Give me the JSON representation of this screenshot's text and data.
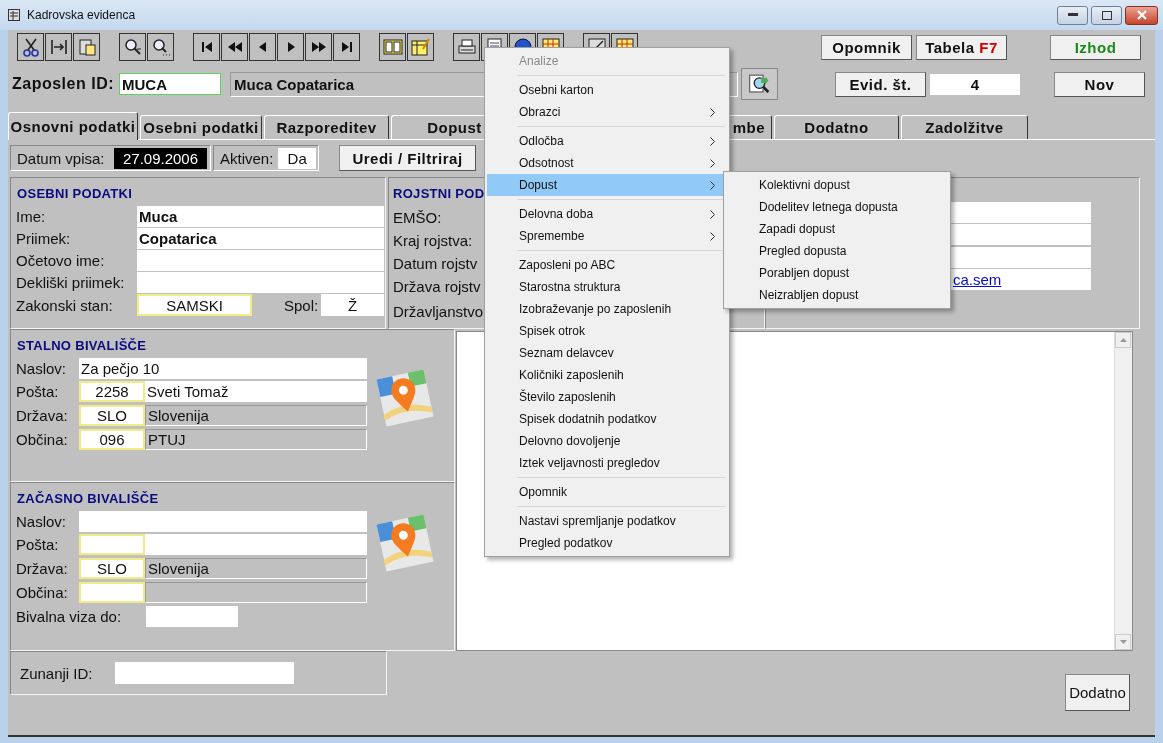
{
  "window": {
    "title": "Kadrovska evidenca"
  },
  "toolbar_buttons": [
    {
      "label": "Opomnik",
      "kind": "plain"
    },
    {
      "label": "Tabela",
      "hotkey": "F7",
      "kind": "hotkey"
    },
    {
      "label": "Izhod",
      "kind": "exit"
    }
  ],
  "employee_bar": {
    "label": "Zaposlen ID:",
    "id_value": "MUCA",
    "name_value": "Muca Copatarica",
    "record_button": "Evid. št.",
    "record_value": "4",
    "new_button": "Nov"
  },
  "tabs": [
    {
      "label": "Osnovni podatki",
      "selected": true
    },
    {
      "label": "Osebni podatki",
      "selected": false
    },
    {
      "label": "Razporeditev",
      "selected": false
    },
    {
      "label": "Dopust",
      "selected": false
    },
    {
      "label": "mbe",
      "selected": false
    },
    {
      "label": "Dodatno",
      "selected": false
    },
    {
      "label": "Zadolžitve",
      "selected": false
    }
  ],
  "entry": {
    "date_label": "Datum vpisa:",
    "date_value": "27.09.2006",
    "active_label": "Aktiven:",
    "active_value": "Da",
    "filter_button": "Uredi / Filtriraj"
  },
  "personal": {
    "title": "OSEBNI PODATKI",
    "rows": [
      {
        "label": "Ime:",
        "value": "Muca"
      },
      {
        "label": "Priimek:",
        "value": "Copatarica"
      },
      {
        "label": "Očetovo ime:"
      },
      {
        "label": "Dekliški priimek:"
      }
    ],
    "marital_label": "Zakonski stan:",
    "marital_value": "SAMSKI",
    "sex_label": "Spol:",
    "sex_value": "Ž"
  },
  "birth": {
    "title": "ROJSTNI POD",
    "labels": [
      "EMŠO:",
      "Kraj rojstva:",
      "Datum rojstv",
      "Država rojstv",
      "Državljanstvo"
    ]
  },
  "contact": {
    "link": "ca.sem"
  },
  "permanent_address": {
    "title": "STALNO BIVALIŠČE",
    "address_label": "Naslov:",
    "address": "Za pečjo 10",
    "rows": [
      {
        "label": "Pošta:",
        "code": "2258",
        "name": "Sveti Tomaž",
        "kind": "editable"
      },
      {
        "label": "Država:",
        "code": "SLO",
        "name": "Slovenija",
        "kind": "lookup"
      },
      {
        "label": "Občina:",
        "code": "096",
        "name": "PTUJ",
        "kind": "lookup"
      }
    ]
  },
  "temporary_address": {
    "title": "ZAČASNO BIVALIŠČE",
    "address_label": "Naslov:",
    "rows": [
      {
        "label": "Pošta:",
        "kind": "editable"
      },
      {
        "label": "Država:",
        "code": "SLO",
        "name": "Slovenija",
        "kind": "lookup"
      },
      {
        "label": "Občina:",
        "kind": "lookup"
      }
    ],
    "visa_label": "Bivalna viza do:"
  },
  "external_id": {
    "label": "Zunanji ID:"
  },
  "notes_button": "Dodatno",
  "context_menu": {
    "items": [
      {
        "kind": "item",
        "label": "Analize",
        "disabled": true,
        "submenu": false,
        "selected": false
      },
      {
        "kind": "separator"
      },
      {
        "kind": "item",
        "label": "Osebni karton",
        "disabled": false,
        "submenu": false,
        "selected": false
      },
      {
        "kind": "item",
        "label": "Obrazci",
        "disabled": false,
        "submenu": true,
        "selected": false
      },
      {
        "kind": "separator"
      },
      {
        "kind": "item",
        "label": "Odločba",
        "disabled": false,
        "submenu": true,
        "selected": false
      },
      {
        "kind": "item",
        "label": "Odsotnost",
        "disabled": false,
        "submenu": true,
        "selected": false
      },
      {
        "kind": "item",
        "label": "Dopust",
        "disabled": false,
        "submenu": true,
        "selected": true
      },
      {
        "kind": "separator"
      },
      {
        "kind": "item",
        "label": "Delovna doba",
        "disabled": false,
        "submenu": true,
        "selected": false
      },
      {
        "kind": "item",
        "label": "Spremembe",
        "disabled": false,
        "submenu": true,
        "selected": false
      },
      {
        "kind": "separator"
      },
      {
        "kind": "item",
        "label": "Zaposleni po ABC",
        "disabled": false,
        "submenu": false,
        "selected": false
      },
      {
        "kind": "item",
        "label": "Starostna struktura",
        "disabled": false,
        "submenu": false,
        "selected": false
      },
      {
        "kind": "item",
        "label": "Izobraževanje po zaposlenih",
        "disabled": false,
        "submenu": false,
        "selected": false
      },
      {
        "kind": "item",
        "label": "Spisek otrok",
        "disabled": false,
        "submenu": false,
        "selected": false
      },
      {
        "kind": "item",
        "label": "Seznam delavcev",
        "disabled": false,
        "submenu": false,
        "selected": false
      },
      {
        "kind": "item",
        "label": "Količniki zaposlenih",
        "disabled": false,
        "submenu": false,
        "selected": false
      },
      {
        "kind": "item",
        "label": "Število zaposlenih",
        "disabled": false,
        "submenu": false,
        "selected": false
      },
      {
        "kind": "item",
        "label": "Spisek dodatnih podatkov",
        "disabled": false,
        "submenu": false,
        "selected": false
      },
      {
        "kind": "item",
        "label": "Delovno dovoljenje",
        "disabled": false,
        "submenu": false,
        "selected": false
      },
      {
        "kind": "item",
        "label": "Iztek veljavnosti pregledov",
        "disabled": false,
        "submenu": false,
        "selected": false
      },
      {
        "kind": "separator"
      },
      {
        "kind": "item",
        "label": "Opomnik",
        "disabled": false,
        "submenu": false,
        "selected": false
      },
      {
        "kind": "separator"
      },
      {
        "kind": "item",
        "label": "Nastavi spremljanje podatkov",
        "disabled": false,
        "submenu": false,
        "selected": false
      },
      {
        "kind": "item",
        "label": "Pregled podatkov",
        "disabled": false,
        "submenu": false,
        "selected": false
      }
    ]
  },
  "submenu": {
    "items": [
      {
        "label": "Kolektivni dopust"
      },
      {
        "label": "Dodelitev letnega dopusta"
      },
      {
        "label": "Zapadi dopust"
      },
      {
        "label": "Pregled dopusta"
      },
      {
        "label": "Porabljen dopust"
      },
      {
        "label": "Neizrabljen dopust"
      }
    ]
  }
}
